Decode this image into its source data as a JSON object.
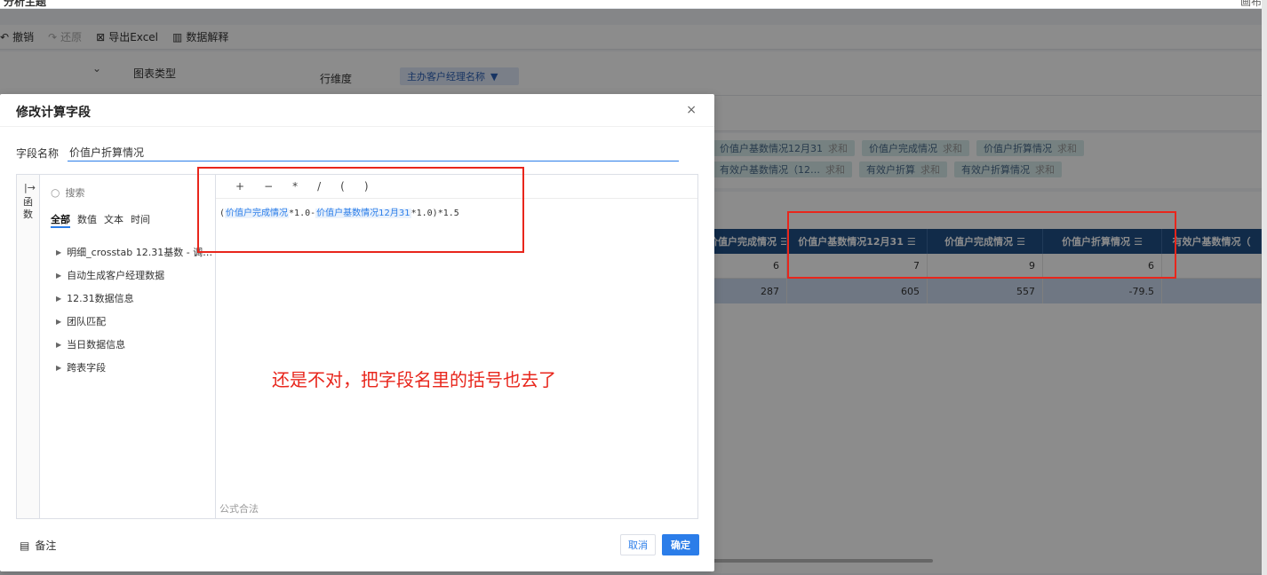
{
  "app": {
    "title": "分析主题",
    "top_right": "画布",
    "toolbar": {
      "undo": "撤销",
      "redo": "还原",
      "export_excel": "导出Excel",
      "data_explain": "数据解释"
    },
    "config": {
      "chart_type_label": "图表类型",
      "row_dim_label": "行维度",
      "row_dim_pill": "主办客户经理名称"
    },
    "measures": [
      {
        "name": "价值户基数情况12月31",
        "agg": "求和"
      },
      {
        "name": "价值户完成情况",
        "agg": "求和"
      },
      {
        "name": "价值户折算情况",
        "agg": "求和"
      },
      {
        "name": "有效户基数情况（12…",
        "agg": "求和"
      },
      {
        "name": "有效户折算",
        "agg": "求和"
      },
      {
        "name": "有效户折算情况",
        "agg": "求和"
      }
    ],
    "grid": {
      "headers": [
        "价值户完成情况",
        "价值户基数情况12月31",
        "价值户完成情况",
        "价值户折算情况",
        "有效户基数情况（"
      ],
      "rows": [
        [
          "6",
          "7",
          "9",
          "6",
          ""
        ],
        [
          "287",
          "605",
          "557",
          "-79.5",
          ""
        ]
      ]
    }
  },
  "modal": {
    "title": "修改计算字段",
    "close": "×",
    "field_label": "字段名称",
    "field_value": "价值户折算情况",
    "rail_text": "函数",
    "search_placeholder": "搜索",
    "filters": [
      "全部",
      "数值",
      "文本",
      "时间"
    ],
    "tree": [
      "明细_crosstab 12.31基数 - 调…",
      "自动生成客户经理数据",
      "12.31数据信息",
      "团队匹配",
      "当日数据信息",
      "跨表字段"
    ],
    "operators": [
      "+",
      "−",
      "*",
      "/",
      "(",
      ")"
    ],
    "formula": {
      "open": "(",
      "field1": "价值户完成情况",
      "mid1": "*1.0-",
      "field2": "价值户基数情况12月31",
      "tail": "*1.0)*1.5"
    },
    "formula_status": "公式合法",
    "note": "备注",
    "cancel": "取消",
    "ok": "确定"
  },
  "annotation": {
    "text": "还是不对，把字段名里的括号也去了",
    "color": "#e8261c"
  }
}
